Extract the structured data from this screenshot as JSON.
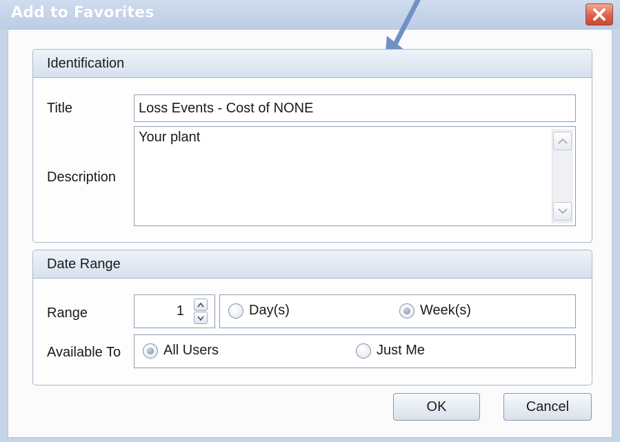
{
  "window": {
    "title": "Add to Favorites",
    "close_icon": "close-icon"
  },
  "annotation": {
    "icon": "arrow-pointer-icon",
    "color": "#6f91c6"
  },
  "identification": {
    "header": "Identification",
    "title_label": "Title",
    "title_value": "Loss Events - Cost of NONE",
    "description_label": "Description",
    "description_value": "Your plant"
  },
  "date_range": {
    "header": "Date Range",
    "range_label": "Range",
    "range_value": "1",
    "unit_options": [
      {
        "label": "Day(s)",
        "checked": false
      },
      {
        "label": "Week(s)",
        "checked": true
      }
    ],
    "available_label": "Available To",
    "availability_options": [
      {
        "label": "All Users",
        "checked": true
      },
      {
        "label": "Just Me",
        "checked": false
      }
    ]
  },
  "buttons": {
    "ok": "OK",
    "cancel": "Cancel"
  }
}
